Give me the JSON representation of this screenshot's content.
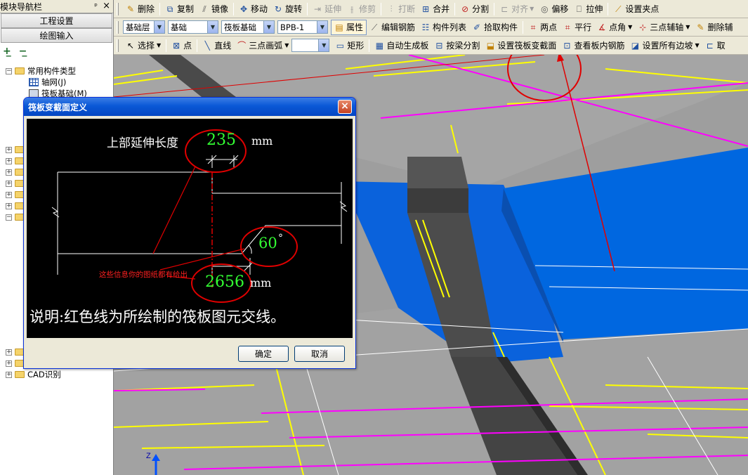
{
  "nav": {
    "title": "模块导航栏",
    "pin": "ᵖ",
    "close": "×",
    "btn_project": "工程设置",
    "btn_draw": "绘图输入",
    "tree": {
      "root": "常用构件类型",
      "axis": "轴网(J)",
      "raft": "筏板基础(M)",
      "cad": "CAD识别"
    }
  },
  "toolbar1": {
    "delete": "删除",
    "copy": "复制",
    "mirror": "镜像",
    "move": "移动",
    "rotate": "旋转",
    "extend": "延伸",
    "trim": "修剪",
    "break": "打断",
    "merge": "合并",
    "split": "分割",
    "align": "对齐",
    "offset": "偏移",
    "stretch": "拉伸",
    "grip": "设置夹点"
  },
  "toolbar2": {
    "floor": "基础层",
    "category": "基础",
    "type": "筏板基础",
    "name": "BPB-1",
    "props": "属性",
    "edit_rebar": "编辑钢筋",
    "list": "构件列表",
    "pick": "拾取构件",
    "two_points": "两点",
    "parallel": "平行",
    "point_angle": "点角",
    "three_aux": "三点辅轴",
    "del_aux": "删除辅"
  },
  "toolbar3": {
    "select": "选择",
    "point": "点",
    "line": "直线",
    "arc": "三点画弧",
    "rect": "矩形",
    "auto_gen": "自动生成板",
    "split_by_beam": "按梁分割",
    "set_var_section": "设置筏板变截面",
    "view_rebar": "查看板内钢筋",
    "set_all_slope": "设置所有边坡",
    "cancel": "取"
  },
  "dialog": {
    "title": "筏板变截面定义",
    "close": "×",
    "upper_label": "上部延伸长度",
    "upper_value": "235",
    "unit": "mm",
    "angle_value": "60",
    "angle_unit": "°",
    "bottom_value": "2656",
    "bottom_unit": "mm",
    "note_red": "这些信息你的图纸都有给出",
    "note": "说明:红色线为所绘制的筏板图元交线。",
    "ok": "确定",
    "cancel": "取消"
  },
  "axis_label": "Z",
  "colors": {
    "blue_slab": "#0067e0",
    "annotation_red": "#e00000",
    "value_green": "#33ff33",
    "grid_yellow": "#ffff00",
    "grid_magenta": "#ff00ff"
  }
}
